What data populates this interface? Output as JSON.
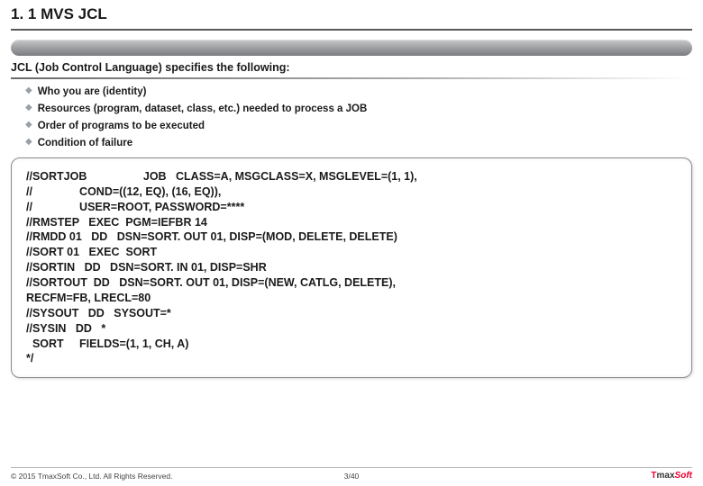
{
  "header": {
    "title": "1. 1 MVS JCL"
  },
  "subtitle": "JCL (Job Control Language) specifies the following:",
  "bullets": [
    "Who you are (identity)",
    "Resources (program, dataset, class, etc.) needed to process a JOB",
    "Order of programs to be executed",
    "Condition of failure"
  ],
  "code": [
    "//SORTJOB                  JOB   CLASS=A, MSGCLASS=X, MSGLEVEL=(1, 1),",
    "//               COND=((12, EQ), (16, EQ)),",
    "//               USER=ROOT, PASSWORD=****",
    "//RMSTEP   EXEC  PGM=IEFBR 14",
    "//RMDD 01   DD   DSN=SORT. OUT 01, DISP=(MOD, DELETE, DELETE)",
    "//SORT 01   EXEC  SORT",
    "//SORTIN   DD   DSN=SORT. IN 01, DISP=SHR",
    "//SORTOUT  DD   DSN=SORT. OUT 01, DISP=(NEW, CATLG, DELETE),",
    "RECFM=FB, LRECL=80",
    "//SYSOUT   DD   SYSOUT=*",
    "//SYSIN   DD   *",
    "  SORT     FIELDS=(1, 1, CH, A)",
    "*/"
  ],
  "footer": {
    "copyright": "© 2015 TmaxSoft Co., Ltd. All Rights Reserved.",
    "page": "3/40",
    "logo_t": "T",
    "logo_max": "max",
    "logo_soft": "Soft"
  }
}
